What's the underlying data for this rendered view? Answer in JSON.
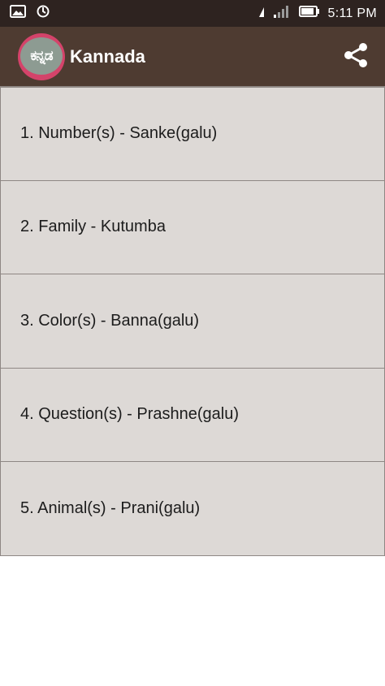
{
  "status_bar": {
    "time": "5:11 PM",
    "icons": [
      "gallery-icon",
      "sync-icon",
      "wifi-icon",
      "signal-icon",
      "battery-icon"
    ]
  },
  "app_bar": {
    "logo_text": "ಕನ್ನಡ",
    "title": "Kannada",
    "share_icon": "share-icon"
  },
  "list": {
    "items": [
      {
        "label": "1. Number(s) - Sanke(galu)"
      },
      {
        "label": "2. Family - Kutumba"
      },
      {
        "label": "3. Color(s) - Banna(galu)"
      },
      {
        "label": "4. Question(s) - Prashne(galu)"
      },
      {
        "label": "5. Animal(s) - Prani(galu)"
      }
    ]
  },
  "colors": {
    "status_bar": "#2e2320",
    "app_bar": "#4e3b31",
    "list_item_bg": "#ddd9d6",
    "divider": "#8e8784",
    "logo_ring": "#d4436a"
  }
}
